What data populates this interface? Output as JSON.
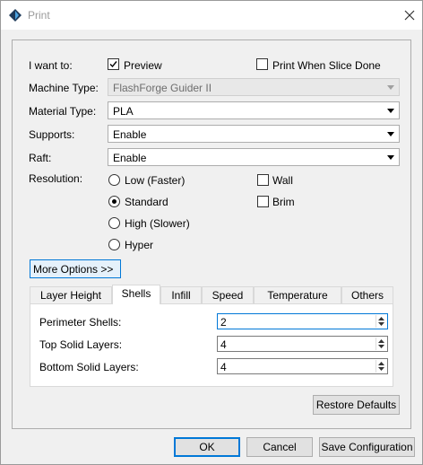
{
  "window": {
    "title": "Print",
    "app_icon": "flashprint-diamond-icon",
    "close_icon": "close-icon"
  },
  "form": {
    "i_want_to_label": "I want to:",
    "preview": {
      "label": "Preview",
      "checked": true
    },
    "print_when_slice_done": {
      "label": "Print When Slice Done",
      "checked": false
    },
    "machine_type": {
      "label": "Machine Type:",
      "value": "FlashForge Guider II",
      "enabled": false
    },
    "material_type": {
      "label": "Material Type:",
      "value": "PLA"
    },
    "supports": {
      "label": "Supports:",
      "value": "Enable"
    },
    "raft": {
      "label": "Raft:",
      "value": "Enable"
    },
    "resolution": {
      "label": "Resolution:",
      "options": [
        {
          "label": "Low (Faster)",
          "selected": false
        },
        {
          "label": "Standard",
          "selected": true
        },
        {
          "label": "High (Slower)",
          "selected": false
        },
        {
          "label": "Hyper",
          "selected": false
        }
      ]
    },
    "wall": {
      "label": "Wall",
      "checked": false
    },
    "brim": {
      "label": "Brim",
      "checked": false
    }
  },
  "more_options_label": "More Options >>",
  "tabs": [
    {
      "label": "Layer Height",
      "active": false
    },
    {
      "label": "Shells",
      "active": true
    },
    {
      "label": "Infill",
      "active": false
    },
    {
      "label": "Speed",
      "active": false
    },
    {
      "label": "Temperature",
      "active": false
    },
    {
      "label": "Others",
      "active": false
    }
  ],
  "shells": {
    "perimeter_shells": {
      "label": "Perimeter Shells:",
      "value": "2"
    },
    "top_solid_layers": {
      "label": "Top Solid Layers:",
      "value": "4"
    },
    "bottom_solid_layers": {
      "label": "Bottom Solid Layers:",
      "value": "4"
    }
  },
  "buttons": {
    "restore_defaults": "Restore Defaults",
    "ok": "OK",
    "cancel": "Cancel",
    "save_configuration": "Save Configuration"
  },
  "colors": {
    "accent": "#0078d7",
    "window_bg": "#f0f0f0",
    "button_bg": "#e1e1e1",
    "more_options_bg": "#e5f1fb"
  }
}
